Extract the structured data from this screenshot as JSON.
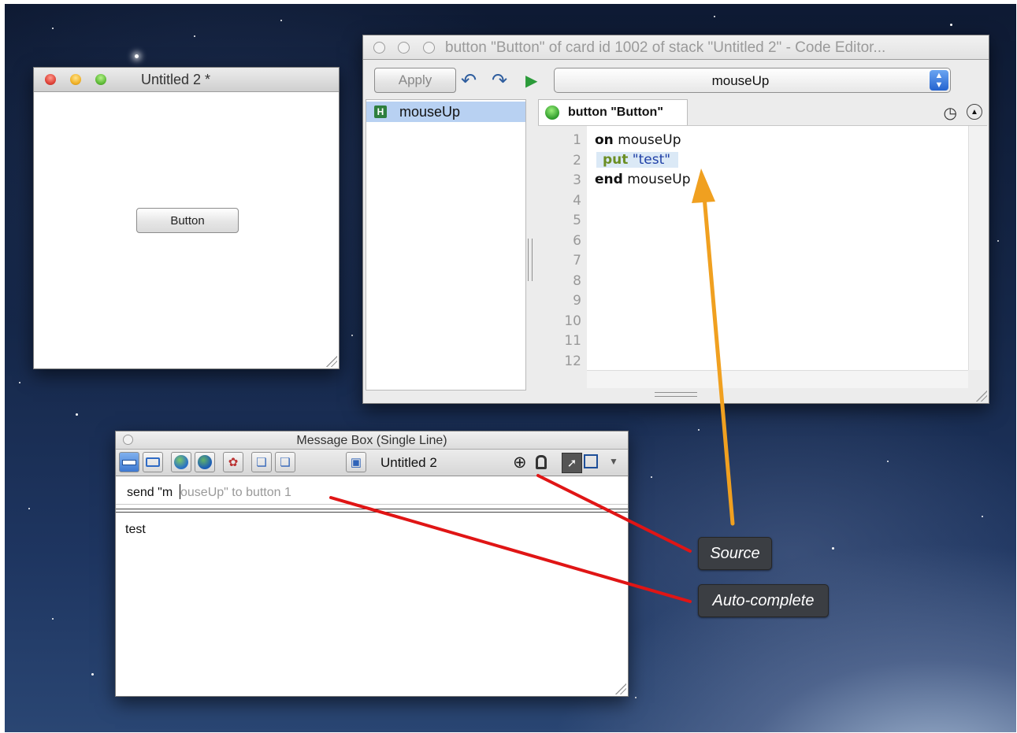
{
  "stack_window": {
    "title": "Untitled 2 *",
    "button_label": "Button"
  },
  "code_editor": {
    "title": "button \"Button\" of card id 1002 of stack \"Untitled 2\" - Code Editor...",
    "apply_label": "Apply",
    "handler_select": "mouseUp",
    "handler_list": [
      {
        "badge": "H",
        "label": "mouseUp"
      }
    ],
    "script_tab": "button \"Button\"",
    "line_numbers": [
      "1",
      "2",
      "3",
      "4",
      "5",
      "6",
      "7",
      "8",
      "9",
      "10",
      "11",
      "12"
    ],
    "lines": [
      {
        "keyword": "on",
        "rest": " mouseUp"
      },
      {
        "keyword": "put",
        "rest": " \"test\""
      },
      {
        "keyword": "end",
        "rest": " mouseUp"
      }
    ]
  },
  "message_box": {
    "title": "Message Box (Single Line)",
    "stack_label": "Untitled 2",
    "input_typed": "send \"m",
    "input_autocomplete": "ouseUp\" to button 1",
    "result": "test"
  },
  "annotations": {
    "source": "Source",
    "autocomplete": "Auto-complete",
    "arrow_color": "#f0a020",
    "line_color": "#e01515"
  }
}
